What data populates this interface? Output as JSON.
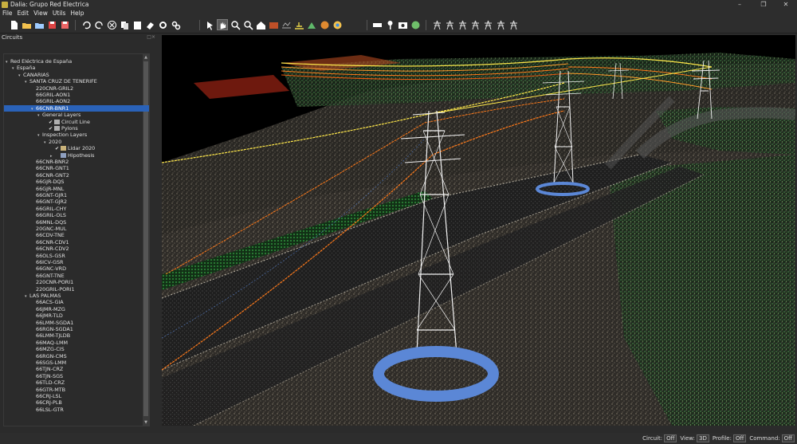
{
  "window": {
    "title": "Dalia: Grupo Red Electrica"
  },
  "menu": [
    "File",
    "Edit",
    "View",
    "Utils",
    "Help"
  ],
  "toolbar": {
    "icons": [
      "new-file-icon",
      "open-folder-icon",
      "open-project-icon",
      "save-icon",
      "save-as-icon",
      "undo-icon",
      "redo-icon",
      "cancel-icon",
      "copy-icon",
      "paste-icon",
      "erase-icon",
      "settings-icon",
      "advanced-settings-icon",
      "select-pointer-icon",
      "pan-hand-icon",
      "zoom-in-icon",
      "zoom-out-icon",
      "home-view-icon",
      "profile-view-icon",
      "surface-view-icon",
      "terrain-icon",
      "classify-icon",
      "color-palette-icon",
      "grid-view-icon",
      "measure-ruler-icon",
      "probe-icon",
      "camera-icon",
      "globe-icon",
      "tower-tool-1-icon",
      "tower-tool-2-icon",
      "tower-tool-3-icon",
      "tower-tool-4-icon",
      "tower-tool-5-icon",
      "tower-tool-6-icon",
      "tower-tool-7-icon"
    ]
  },
  "panel": {
    "title": "Circuits",
    "float_button": "□×"
  },
  "tree": [
    {
      "depth": 0,
      "label": "Red Eléctrica de España",
      "arrow": "▾"
    },
    {
      "depth": 1,
      "label": "España",
      "arrow": "▾"
    },
    {
      "depth": 2,
      "label": "CANARIAS",
      "arrow": "▾"
    },
    {
      "depth": 3,
      "label": "SANTA CRUZ DE TENERIFE",
      "arrow": "▾"
    },
    {
      "depth": 4,
      "label": "220CNR-GRIL2",
      "arrow": ""
    },
    {
      "depth": 4,
      "label": "66GRIL-AON1",
      "arrow": ""
    },
    {
      "depth": 4,
      "label": "66GRIL-AON2",
      "arrow": ""
    },
    {
      "depth": 4,
      "label": "66CNR-BNR1",
      "arrow": "▾",
      "selected": true
    },
    {
      "depth": 5,
      "label": "General Layers",
      "arrow": "▾"
    },
    {
      "depth": 6,
      "label": "Circuit Line",
      "arrow": "",
      "check": "✔",
      "icon": "circuit-line-icon"
    },
    {
      "depth": 6,
      "label": "Pylons",
      "arrow": "",
      "check": "✔",
      "icon": "pylon-icon"
    },
    {
      "depth": 5,
      "label": "Inspection Layers",
      "arrow": "▾"
    },
    {
      "depth": 6,
      "label": "2020",
      "arrow": "▾"
    },
    {
      "depth": 7,
      "label": "Lidar 2020",
      "arrow": "",
      "check": "✔",
      "icon": "lidar-folder-icon"
    },
    {
      "depth": 7,
      "label": "Hipothesis",
      "arrow": "▸",
      "check": "",
      "icon": "hypothesis-icon"
    },
    {
      "depth": 4,
      "label": "66CNR-BNR2",
      "arrow": ""
    },
    {
      "depth": 4,
      "label": "66CNR-GNT1",
      "arrow": ""
    },
    {
      "depth": 4,
      "label": "66CNR-GNT2",
      "arrow": ""
    },
    {
      "depth": 4,
      "label": "66GJR-DQS",
      "arrow": ""
    },
    {
      "depth": 4,
      "label": "66GJR-MNL",
      "arrow": ""
    },
    {
      "depth": 4,
      "label": "66GNT-GJR1",
      "arrow": ""
    },
    {
      "depth": 4,
      "label": "66GNT-GJR2",
      "arrow": ""
    },
    {
      "depth": 4,
      "label": "66GRIL-CHY",
      "arrow": ""
    },
    {
      "depth": 4,
      "label": "66GRIL-OLS",
      "arrow": ""
    },
    {
      "depth": 4,
      "label": "66MNL-DQS",
      "arrow": ""
    },
    {
      "depth": 4,
      "label": "20GNC-MUL",
      "arrow": ""
    },
    {
      "depth": 4,
      "label": "66CDV-TNE",
      "arrow": ""
    },
    {
      "depth": 4,
      "label": "66CNR-CDV1",
      "arrow": ""
    },
    {
      "depth": 4,
      "label": "66CNR-CDV2",
      "arrow": ""
    },
    {
      "depth": 4,
      "label": "66OLS-GSR",
      "arrow": ""
    },
    {
      "depth": 4,
      "label": "66ICV-GSR",
      "arrow": ""
    },
    {
      "depth": 4,
      "label": "66GNC-VRD",
      "arrow": ""
    },
    {
      "depth": 4,
      "label": "66GNT-TNE",
      "arrow": ""
    },
    {
      "depth": 4,
      "label": "220CNR-PORI1",
      "arrow": ""
    },
    {
      "depth": 4,
      "label": "220GRIL-PORI1",
      "arrow": ""
    },
    {
      "depth": 3,
      "label": "LAS PALMAS",
      "arrow": "▾"
    },
    {
      "depth": 4,
      "label": "66ACS-GIA",
      "arrow": ""
    },
    {
      "depth": 4,
      "label": "66JMR-MZG",
      "arrow": ""
    },
    {
      "depth": 4,
      "label": "66JMR-TLD",
      "arrow": ""
    },
    {
      "depth": 4,
      "label": "66LMM-SGDA1",
      "arrow": ""
    },
    {
      "depth": 4,
      "label": "66RGN-SGDA1",
      "arrow": ""
    },
    {
      "depth": 4,
      "label": "66LMM-TJLDB",
      "arrow": ""
    },
    {
      "depth": 4,
      "label": "66MAQ-LMM",
      "arrow": ""
    },
    {
      "depth": 4,
      "label": "66MZG-CIS",
      "arrow": ""
    },
    {
      "depth": 4,
      "label": "66RGN-CMS",
      "arrow": ""
    },
    {
      "depth": 4,
      "label": "66SGS-LMM",
      "arrow": ""
    },
    {
      "depth": 4,
      "label": "66TJN-CRZ",
      "arrow": ""
    },
    {
      "depth": 4,
      "label": "66TJN-SGS",
      "arrow": ""
    },
    {
      "depth": 4,
      "label": "66TLD-CRZ",
      "arrow": ""
    },
    {
      "depth": 4,
      "label": "66GTR-MTB",
      "arrow": ""
    },
    {
      "depth": 4,
      "label": "66CRJ-LSL",
      "arrow": ""
    },
    {
      "depth": 4,
      "label": "66CRJ-PLB",
      "arrow": ""
    },
    {
      "depth": 4,
      "label": "66LSL-GTR",
      "arrow": ""
    }
  ],
  "status": {
    "circuit_label": "Circuit:",
    "circuit_value": "Off",
    "view_label": "View:",
    "view_value": "3D",
    "profile_label": "Profile:",
    "profile_value": "Off",
    "command_label": "Command:",
    "command_value": "Off"
  },
  "colors": {
    "selection": "#2a62b8",
    "pylon_ring": "#5b87d6",
    "conductor_orange": "#ff7a1a",
    "conductor_yellow": "#ffe84a",
    "vegetation": "#3f8f4a",
    "terrain": "#7d7466"
  }
}
